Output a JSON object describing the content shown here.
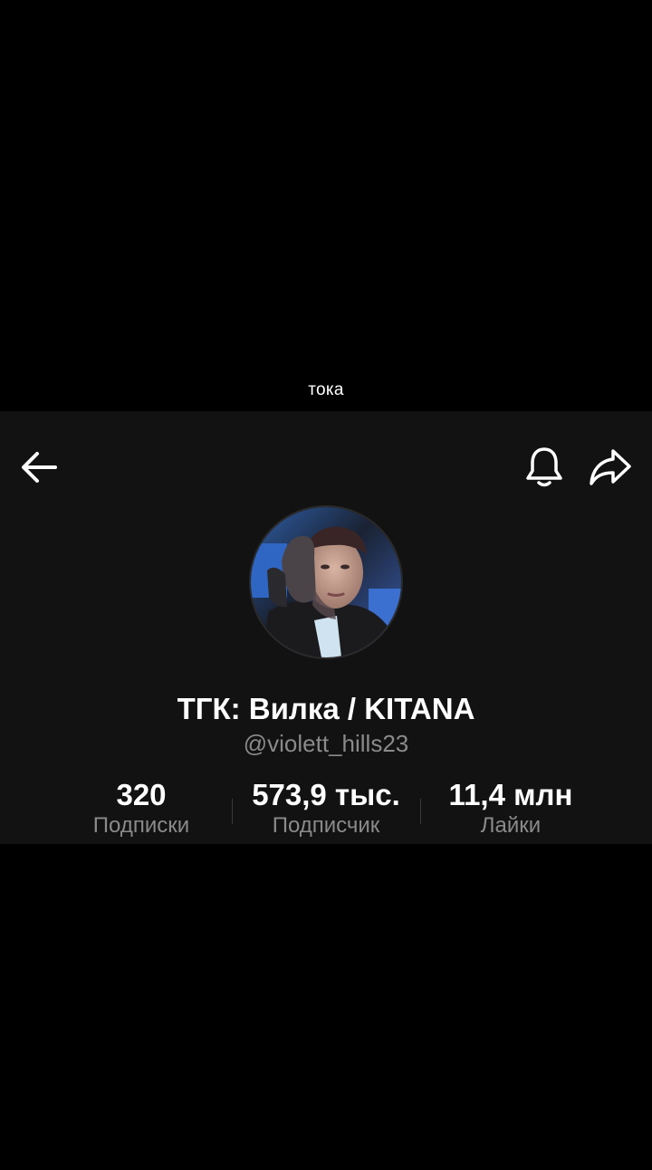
{
  "caption": "тока",
  "topbar": {
    "back_icon": "arrow-left-icon",
    "bell_icon": "bell-icon",
    "share_icon": "share-arrow-icon"
  },
  "profile": {
    "display_name": "ТГК: Вилка / KITANA",
    "username": "@violett_hills23"
  },
  "stats": {
    "following": {
      "value": "320",
      "label": "Подписки"
    },
    "followers": {
      "value": "573,9 тыс.",
      "label": "Подписчик"
    },
    "likes": {
      "value": "11,4 млн",
      "label": "Лайки"
    }
  },
  "colors": {
    "background": "#000000",
    "panel": "#121212",
    "primary_text": "#ffffff",
    "secondary_text": "#8a8a8a"
  }
}
